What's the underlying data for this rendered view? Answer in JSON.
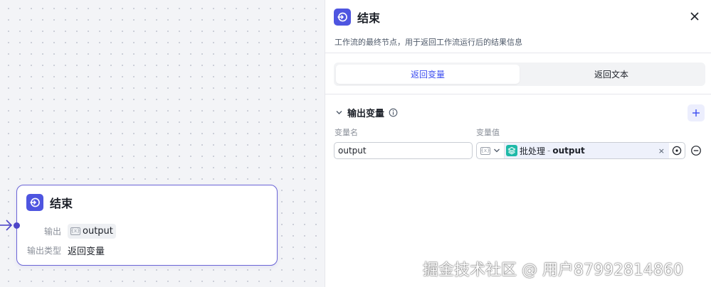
{
  "canvas": {
    "node": {
      "title": "结束",
      "icon": "end-node-icon",
      "rows": [
        {
          "label": "输出",
          "value": "output"
        },
        {
          "label": "输出类型",
          "value": "返回变量"
        }
      ]
    }
  },
  "panel": {
    "title": "结束",
    "description": "工作流的最终节点，用于返回工作流运行后的结果信息",
    "tabs": [
      {
        "label": "返回变量",
        "active": true
      },
      {
        "label": "返回文本",
        "active": false
      }
    ],
    "section": {
      "title": "输出变量",
      "name_col": "变量名",
      "value_col": "变量值",
      "row": {
        "name": "output",
        "ref_node": "批处理",
        "ref_sep": "-",
        "ref_var": "output"
      }
    }
  },
  "watermark": "掘金技术社区 @ 用户87992814860",
  "colors": {
    "accent": "#4e55e0",
    "tab_active_text": "#3b4cf0",
    "node_border": "#6b65d6",
    "ref_icon": "#1fb9a8"
  }
}
